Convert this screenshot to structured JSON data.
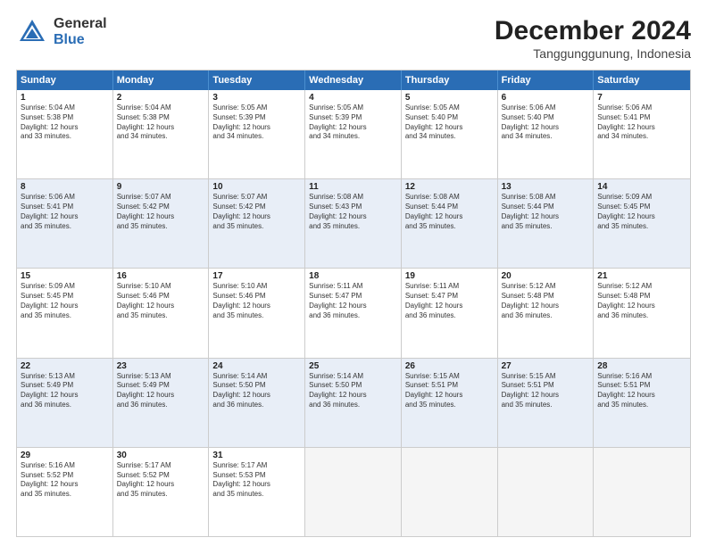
{
  "logo": {
    "general": "General",
    "blue": "Blue"
  },
  "title": "December 2024",
  "subtitle": "Tanggunggunung, Indonesia",
  "headers": [
    "Sunday",
    "Monday",
    "Tuesday",
    "Wednesday",
    "Thursday",
    "Friday",
    "Saturday"
  ],
  "rows": [
    [
      {
        "day": "1",
        "text": "Sunrise: 5:04 AM\nSunset: 5:38 PM\nDaylight: 12 hours\nand 33 minutes."
      },
      {
        "day": "2",
        "text": "Sunrise: 5:04 AM\nSunset: 5:38 PM\nDaylight: 12 hours\nand 34 minutes."
      },
      {
        "day": "3",
        "text": "Sunrise: 5:05 AM\nSunset: 5:39 PM\nDaylight: 12 hours\nand 34 minutes."
      },
      {
        "day": "4",
        "text": "Sunrise: 5:05 AM\nSunset: 5:39 PM\nDaylight: 12 hours\nand 34 minutes."
      },
      {
        "day": "5",
        "text": "Sunrise: 5:05 AM\nSunset: 5:40 PM\nDaylight: 12 hours\nand 34 minutes."
      },
      {
        "day": "6",
        "text": "Sunrise: 5:06 AM\nSunset: 5:40 PM\nDaylight: 12 hours\nand 34 minutes."
      },
      {
        "day": "7",
        "text": "Sunrise: 5:06 AM\nSunset: 5:41 PM\nDaylight: 12 hours\nand 34 minutes."
      }
    ],
    [
      {
        "day": "8",
        "text": "Sunrise: 5:06 AM\nSunset: 5:41 PM\nDaylight: 12 hours\nand 35 minutes."
      },
      {
        "day": "9",
        "text": "Sunrise: 5:07 AM\nSunset: 5:42 PM\nDaylight: 12 hours\nand 35 minutes."
      },
      {
        "day": "10",
        "text": "Sunrise: 5:07 AM\nSunset: 5:42 PM\nDaylight: 12 hours\nand 35 minutes."
      },
      {
        "day": "11",
        "text": "Sunrise: 5:08 AM\nSunset: 5:43 PM\nDaylight: 12 hours\nand 35 minutes."
      },
      {
        "day": "12",
        "text": "Sunrise: 5:08 AM\nSunset: 5:44 PM\nDaylight: 12 hours\nand 35 minutes."
      },
      {
        "day": "13",
        "text": "Sunrise: 5:08 AM\nSunset: 5:44 PM\nDaylight: 12 hours\nand 35 minutes."
      },
      {
        "day": "14",
        "text": "Sunrise: 5:09 AM\nSunset: 5:45 PM\nDaylight: 12 hours\nand 35 minutes."
      }
    ],
    [
      {
        "day": "15",
        "text": "Sunrise: 5:09 AM\nSunset: 5:45 PM\nDaylight: 12 hours\nand 35 minutes."
      },
      {
        "day": "16",
        "text": "Sunrise: 5:10 AM\nSunset: 5:46 PM\nDaylight: 12 hours\nand 35 minutes."
      },
      {
        "day": "17",
        "text": "Sunrise: 5:10 AM\nSunset: 5:46 PM\nDaylight: 12 hours\nand 35 minutes."
      },
      {
        "day": "18",
        "text": "Sunrise: 5:11 AM\nSunset: 5:47 PM\nDaylight: 12 hours\nand 36 minutes."
      },
      {
        "day": "19",
        "text": "Sunrise: 5:11 AM\nSunset: 5:47 PM\nDaylight: 12 hours\nand 36 minutes."
      },
      {
        "day": "20",
        "text": "Sunrise: 5:12 AM\nSunset: 5:48 PM\nDaylight: 12 hours\nand 36 minutes."
      },
      {
        "day": "21",
        "text": "Sunrise: 5:12 AM\nSunset: 5:48 PM\nDaylight: 12 hours\nand 36 minutes."
      }
    ],
    [
      {
        "day": "22",
        "text": "Sunrise: 5:13 AM\nSunset: 5:49 PM\nDaylight: 12 hours\nand 36 minutes."
      },
      {
        "day": "23",
        "text": "Sunrise: 5:13 AM\nSunset: 5:49 PM\nDaylight: 12 hours\nand 36 minutes."
      },
      {
        "day": "24",
        "text": "Sunrise: 5:14 AM\nSunset: 5:50 PM\nDaylight: 12 hours\nand 36 minutes."
      },
      {
        "day": "25",
        "text": "Sunrise: 5:14 AM\nSunset: 5:50 PM\nDaylight: 12 hours\nand 36 minutes."
      },
      {
        "day": "26",
        "text": "Sunrise: 5:15 AM\nSunset: 5:51 PM\nDaylight: 12 hours\nand 35 minutes."
      },
      {
        "day": "27",
        "text": "Sunrise: 5:15 AM\nSunset: 5:51 PM\nDaylight: 12 hours\nand 35 minutes."
      },
      {
        "day": "28",
        "text": "Sunrise: 5:16 AM\nSunset: 5:51 PM\nDaylight: 12 hours\nand 35 minutes."
      }
    ],
    [
      {
        "day": "29",
        "text": "Sunrise: 5:16 AM\nSunset: 5:52 PM\nDaylight: 12 hours\nand 35 minutes."
      },
      {
        "day": "30",
        "text": "Sunrise: 5:17 AM\nSunset: 5:52 PM\nDaylight: 12 hours\nand 35 minutes."
      },
      {
        "day": "31",
        "text": "Sunrise: 5:17 AM\nSunset: 5:53 PM\nDaylight: 12 hours\nand 35 minutes."
      },
      {
        "day": "",
        "text": ""
      },
      {
        "day": "",
        "text": ""
      },
      {
        "day": "",
        "text": ""
      },
      {
        "day": "",
        "text": ""
      }
    ]
  ],
  "alt_rows": [
    1,
    3
  ]
}
